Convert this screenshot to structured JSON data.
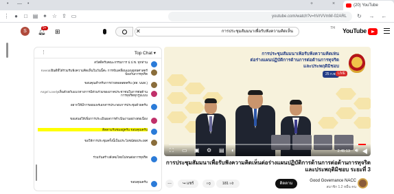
{
  "browser": {
    "tab_title": "(20) YouTube",
    "url": "youtube.com/watch?v=hVrVVmM-02ARL",
    "tab_close": "×",
    "new_tab": "+",
    "ctl_minus": "—",
    "ctl_dot": "•"
  },
  "masthead": {
    "logo_text": "YouTube",
    "country_code": "TH",
    "search_value": "การประชุมสัมมนาเพื่อรับฟังความคิดเห็น",
    "search_clear": "✕",
    "avatar_letter": "S",
    "notif_count": "9+"
  },
  "chat": {
    "title": "Top Chat",
    "messages": [
      {
        "text": "สวัสดีครับคณะกรรมการ ป.ป.ช. ทุกท่าน",
        "author": "",
        "color": "#2b7bd8"
      },
      {
        "text": "ยินดีที่ได้ร่วมรับฟังความคิดเห็นในวันนี้ค่ะ การขับเคลื่อนแผนยุทธศาสตร์ป้องกันการทุจริต",
        "author": "Keerati",
        "color": "#8a6d3b"
      },
      {
        "text": "ขอบคุณสำหรับการถ่ายทอดสดครับ (สส. นนท.)",
        "author": "",
        "color": "#8a6d3b"
      },
      {
        "text": "เห็นด้วยกับแนวทางการมีส่วนร่วมของภาคประชาชนในการต่อต้านการทุจริตทุกรูปแบบ",
        "author": "Angel Lovely",
        "color": "#c0306a"
      },
      {
        "text": "อยากให้มีการเผยแพร่เอกสารประกอบการประชุมด้วยครับ",
        "author": "",
        "color": "#2b7bd8"
      },
      {
        "text": "ขอเสนอให้เพิ่มการประเมินผลการดำเนินงานอย่างต่อเนื่อง",
        "author": "",
        "color": "#c0306a"
      },
      {
        "text": "ติดตามรับชมอยู่ครับ ขอบคุณครับ",
        "author": "",
        "color": "#2b7bd8",
        "highlight": true
      },
      {
        "text": "ขอให้การประชุมครั้งนี้เป็นประโยชน์ต่อประเทศ",
        "author": "",
        "color": "#8a6d3b"
      },
      {
        "text": "ร่วมกันสร้างสังคมไทยไม่ทนต่อการทุจริต",
        "author": "",
        "color": "#2b7bd8"
      },
      {
        "text": "ขอบคุณครับ",
        "author": "",
        "color": "#2b7bd8"
      }
    ]
  },
  "video": {
    "title_line1": "การประชุมสัมมนาเพื่อรับฟังความคิดเห็น",
    "title_line2": "ต่อร่างแผนปฏิบัติการด้านการต่อต้านการทุจริต",
    "title_line3": "และประพฤติมิชอบ",
    "date_tag": "25 ก.พ.",
    "live_tag": "LIVE",
    "time_display": "2:45:13",
    "progress": 0.04
  },
  "below": {
    "title": "การประชุมสัมมนาเพื่อรับฟังความคิดเห็นต่อร่างแผนปฏิบัติการด้านการต่อต้านการทุจริตและประพฤติมิชอบ ระยะที่ 3",
    "channel_name": "Good Governance NACC",
    "channel_subs": "สมาชิก 1.2 หมื่น คน",
    "subscribe": "ติดตาม",
    "likes": "181",
    "share": "แชร์",
    "more": "..."
  }
}
